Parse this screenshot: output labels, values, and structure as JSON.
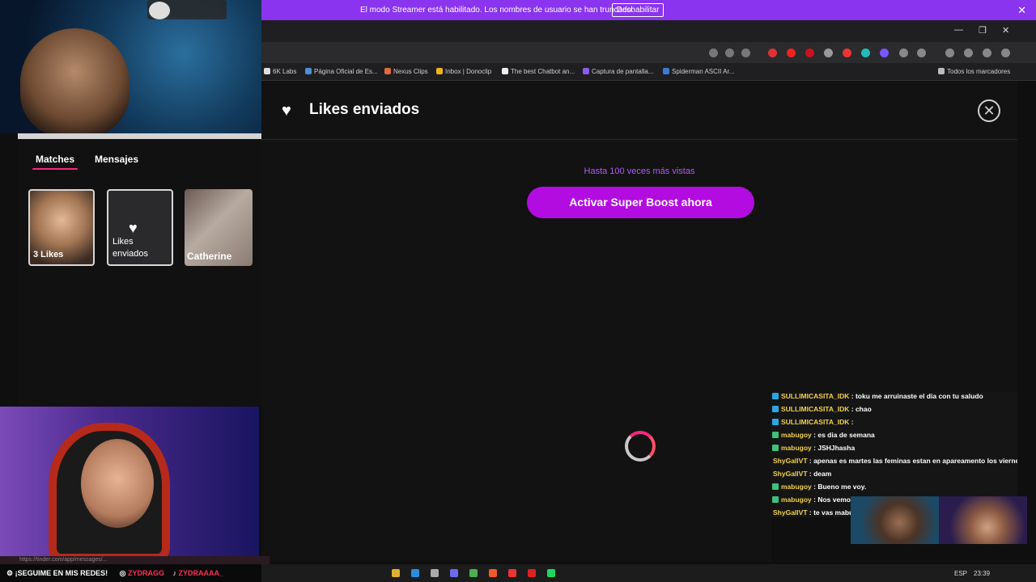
{
  "streamer_banner": {
    "message": "El modo Streamer está habilitado. Los nombres de usuario se han truncado.",
    "button_label": "Deshabilitar",
    "close_glyph": "✕"
  },
  "window_controls": {
    "minimize": "—",
    "restore": "❐",
    "close": "✕"
  },
  "bookmarks": [
    "6K Labs",
    "Página Oficial de Es...",
    "Nexus Clips",
    "Inbox | Donoclip",
    "The best Chatbot an...",
    "Captura de pantalla...",
    "Spiderman ASCII Ar...",
    "Todos los marcadores"
  ],
  "left_panel": {
    "tabs": {
      "matches": "Matches",
      "messages": "Mensajes"
    },
    "cards": {
      "likes": "3 Likes",
      "sent_line1": "Likes",
      "sent_line2": "enviados",
      "match_name": "Catherine"
    }
  },
  "main": {
    "title": "Likes enviados",
    "boost_subtitle": "Hasta 100 veces más vistas",
    "boost_button": "Activar Super Boost ahora",
    "close_glyph": "✕"
  },
  "chat": [
    {
      "user": "SULLIMICASITA_IDK",
      "text": ": toku me arruinaste el dia con tu saludo",
      "color": "#f2d24b",
      "badge": "#2aa7e0"
    },
    {
      "user": "SULLIMICASITA_IDK",
      "text": ": chao",
      "color": "#f2d24b",
      "badge": "#2aa7e0"
    },
    {
      "user": "SULLIMICASITA_IDK",
      "text": ":",
      "color": "#f2d24b",
      "badge": "#2aa7e0"
    },
    {
      "user": "mabugoy",
      "text": ": es dia de semana",
      "color": "#f2d24b",
      "badge": "#3cc27a"
    },
    {
      "user": "mabugoy",
      "text": ": JSHJhasha",
      "color": "#f2d24b",
      "badge": "#3cc27a"
    },
    {
      "user": "ShyGallVT",
      "text": ": apenas es martes las feminas estan en apareamento los viernes",
      "color": "#f2d24b",
      "badge": ""
    },
    {
      "user": "ShyGallVT",
      "text": ": deam",
      "color": "#f2d24b",
      "badge": ""
    },
    {
      "user": "mabugoy",
      "text": ": Bueno me voy.",
      "color": "#f2d24b",
      "badge": "#3cc27a"
    },
    {
      "user": "mabugoy",
      "text": ": Nos vemos.",
      "color": "#f2d24b",
      "badge": "#3cc27a"
    },
    {
      "user": "ShyGallVT",
      "text": ": te vas mabu?",
      "color": "#f2d24b",
      "badge": ""
    }
  ],
  "overlay": {
    "social_prefix": "¡SEGUIME EN MIS REDES!",
    "instagram": "ZYDRAGG",
    "tiktok": "ZYDRAAAA_",
    "status_url": "https://tinder.com/app/messages/..."
  },
  "taskbar": {
    "lang": "ESP",
    "time": "23:39"
  },
  "colors": {
    "accent": "#8b34f0",
    "boost": "#b20ce0",
    "tinder": "#fd267d"
  }
}
